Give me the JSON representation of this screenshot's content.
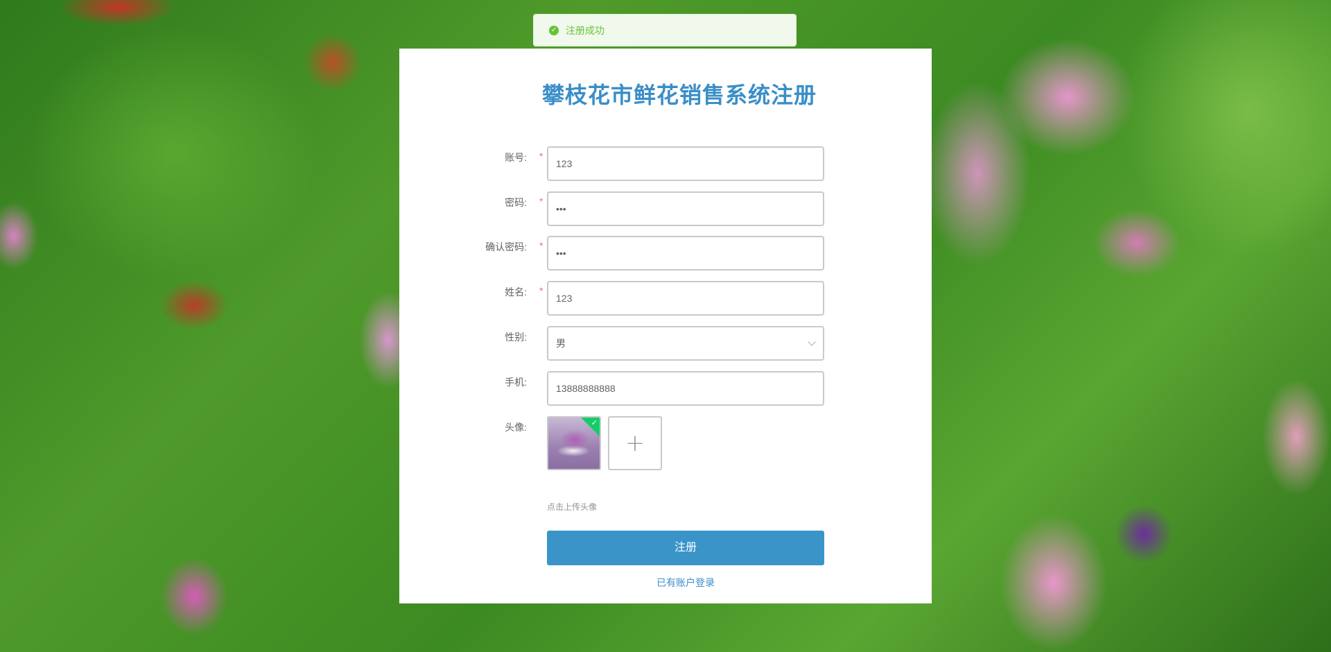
{
  "toast": {
    "icon": "check-circle-icon",
    "text": "注册成功",
    "color": "#67c23a"
  },
  "form": {
    "title": "攀枝花市鲜花销售系统注册",
    "account": {
      "label": "账号:",
      "required": "*",
      "value": "123"
    },
    "password": {
      "label": "密码:",
      "required": "*",
      "value": "•••"
    },
    "confirm_password": {
      "label": "确认密码:",
      "required": "*",
      "value": "•••"
    },
    "name": {
      "label": "姓名:",
      "required": "*",
      "value": "123"
    },
    "gender": {
      "label": "性别:",
      "value": "男"
    },
    "phone": {
      "label": "手机:",
      "value": "13888888888"
    },
    "avatar": {
      "label": "头像:",
      "add_symbol": "+",
      "uploaded_badge": "✓",
      "tip": "点击上传头像"
    },
    "submit_label": "注册",
    "login_link": "已有账户登录"
  },
  "colors": {
    "accent": "#3a94c8",
    "title": "#3a8ec8",
    "required": "#f56c6c",
    "success": "#67c23a"
  }
}
